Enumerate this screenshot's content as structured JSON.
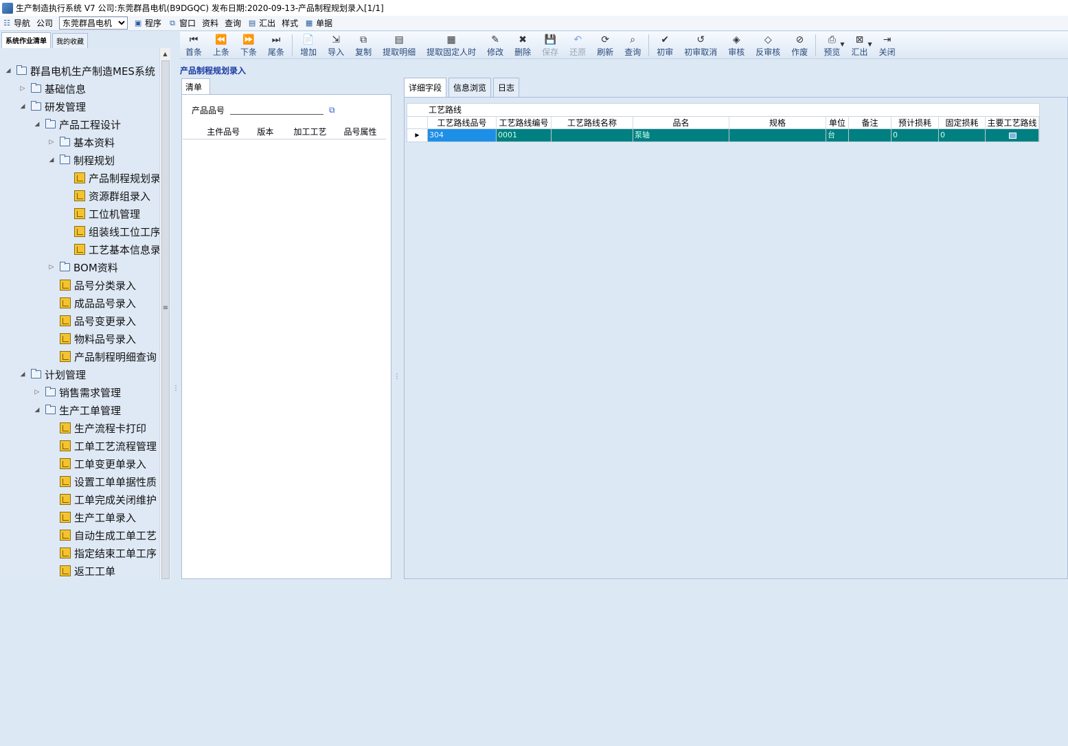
{
  "window": {
    "title": "生产制造执行系统 V7 公司:东莞群昌电机(B9DGQC) 发布日期:2020-09-13-产品制程规划录入[1/1]"
  },
  "menu": {
    "nav": "导航",
    "company_label": "公司",
    "company_value": "东莞群昌电机",
    "program": "程序",
    "window": "窗口",
    "data": "资料",
    "query": "查询",
    "summary": "汇出",
    "style": "样式",
    "bill": "单据"
  },
  "left_tabs": [
    "系统作业清单",
    "我的收藏"
  ],
  "tree": [
    {
      "label": "群昌电机生产制造MES系统",
      "level": 0,
      "type": "folder",
      "state": "open"
    },
    {
      "label": "基础信息",
      "level": 1,
      "type": "folder",
      "state": "closed"
    },
    {
      "label": "研发管理",
      "level": 1,
      "type": "folder",
      "state": "open"
    },
    {
      "label": "产品工程设计",
      "level": 2,
      "type": "folder",
      "state": "open"
    },
    {
      "label": "基本资料",
      "level": 3,
      "type": "folder",
      "state": "closed"
    },
    {
      "label": "制程规划",
      "level": 3,
      "type": "folder",
      "state": "open"
    },
    {
      "label": "产品制程规划录",
      "level": 4,
      "type": "leaf"
    },
    {
      "label": "资源群组录入",
      "level": 4,
      "type": "leaf"
    },
    {
      "label": "工位机管理",
      "level": 4,
      "type": "leaf"
    },
    {
      "label": "组装线工位工序",
      "level": 4,
      "type": "leaf"
    },
    {
      "label": "工艺基本信息录",
      "level": 4,
      "type": "leaf"
    },
    {
      "label": "BOM资料",
      "level": 3,
      "type": "folder",
      "state": "closed"
    },
    {
      "label": "品号分类录入",
      "level": 3,
      "type": "leaf"
    },
    {
      "label": "成品品号录入",
      "level": 3,
      "type": "leaf"
    },
    {
      "label": "品号变更录入",
      "level": 3,
      "type": "leaf"
    },
    {
      "label": "物料品号录入",
      "level": 3,
      "type": "leaf"
    },
    {
      "label": "产品制程明细查询",
      "level": 3,
      "type": "leaf"
    },
    {
      "label": "计划管理",
      "level": 1,
      "type": "folder",
      "state": "open"
    },
    {
      "label": "销售需求管理",
      "level": 2,
      "type": "folder",
      "state": "closed"
    },
    {
      "label": "生产工单管理",
      "level": 2,
      "type": "folder",
      "state": "open"
    },
    {
      "label": "生产流程卡打印",
      "level": 3,
      "type": "leaf"
    },
    {
      "label": "工单工艺流程管理",
      "level": 3,
      "type": "leaf"
    },
    {
      "label": "工单变更单录入",
      "level": 3,
      "type": "leaf"
    },
    {
      "label": "设置工单单据性质",
      "level": 3,
      "type": "leaf"
    },
    {
      "label": "工单完成关闭维护",
      "level": 3,
      "type": "leaf"
    },
    {
      "label": "生产工单录入",
      "level": 3,
      "type": "leaf"
    },
    {
      "label": "自动生成工单工艺",
      "level": 3,
      "type": "leaf"
    },
    {
      "label": "指定结束工单工序",
      "level": 3,
      "type": "leaf"
    },
    {
      "label": "返工工单",
      "level": 3,
      "type": "leaf"
    }
  ],
  "toolbar": [
    {
      "label": "首条",
      "icon": "first-icon",
      "glyph": "⏮"
    },
    {
      "label": "上条",
      "icon": "prev-icon",
      "glyph": "⏪"
    },
    {
      "label": "下条",
      "icon": "next-icon",
      "glyph": "⏩"
    },
    {
      "label": "尾条",
      "icon": "last-icon",
      "glyph": "⏭"
    },
    {
      "sep": true
    },
    {
      "label": "增加",
      "icon": "add-icon",
      "glyph": "📄"
    },
    {
      "label": "导入",
      "icon": "import-icon",
      "glyph": "⇲"
    },
    {
      "label": "复制",
      "icon": "copy-icon",
      "glyph": "⧉"
    },
    {
      "label": "提取明细",
      "icon": "extract-detail-icon",
      "glyph": "▤"
    },
    {
      "label": "提取固定人时",
      "icon": "extract-hours-icon",
      "glyph": "▦"
    },
    {
      "label": "修改",
      "icon": "edit-icon",
      "glyph": "✎"
    },
    {
      "label": "删除",
      "icon": "delete-icon",
      "glyph": "✖"
    },
    {
      "label": "保存",
      "icon": "save-icon",
      "glyph": "💾",
      "disabled": true
    },
    {
      "label": "还原",
      "icon": "undo-icon",
      "glyph": "↶",
      "disabled": true
    },
    {
      "label": "刷新",
      "icon": "refresh-icon",
      "glyph": "⟳"
    },
    {
      "label": "查询",
      "icon": "query-icon",
      "glyph": "⌕"
    },
    {
      "sep": true
    },
    {
      "label": "初审",
      "icon": "check-icon",
      "glyph": "✔"
    },
    {
      "label": "初审取消",
      "icon": "check-cancel-icon",
      "glyph": "↺"
    },
    {
      "label": "审核",
      "icon": "approve-icon",
      "glyph": "◈"
    },
    {
      "label": "反审核",
      "icon": "unapprove-icon",
      "glyph": "◇"
    },
    {
      "label": "作废",
      "icon": "void-icon",
      "glyph": "⊘"
    },
    {
      "sep": true
    },
    {
      "label": "预览",
      "icon": "preview-icon",
      "glyph": "⎙",
      "dropdown": true
    },
    {
      "label": "汇出",
      "icon": "export-icon",
      "glyph": "⊠",
      "dropdown": true
    },
    {
      "label": "关闭",
      "icon": "close-icon",
      "glyph": "⇥"
    }
  ],
  "doc_title": "产品制程规划录入",
  "list_tab": "清单",
  "filter": {
    "label": "产品品号"
  },
  "list_columns": [
    "主件品号",
    "版本",
    "加工工艺",
    "品号属性"
  ],
  "right_tabs": [
    "详细字段",
    "信息浏览",
    "日志"
  ],
  "grid": {
    "group": "工艺路线",
    "columns": [
      "工艺路线品号",
      "工艺路线编号",
      "工艺路线名称",
      "品名",
      "规格",
      "单位",
      "备注",
      "预计损耗",
      "固定损耗",
      "主要工艺路线"
    ],
    "rows": [
      [
        "304",
        "0001",
        "",
        "泵轴",
        "",
        "台",
        "",
        "0",
        "0",
        ""
      ]
    ]
  }
}
